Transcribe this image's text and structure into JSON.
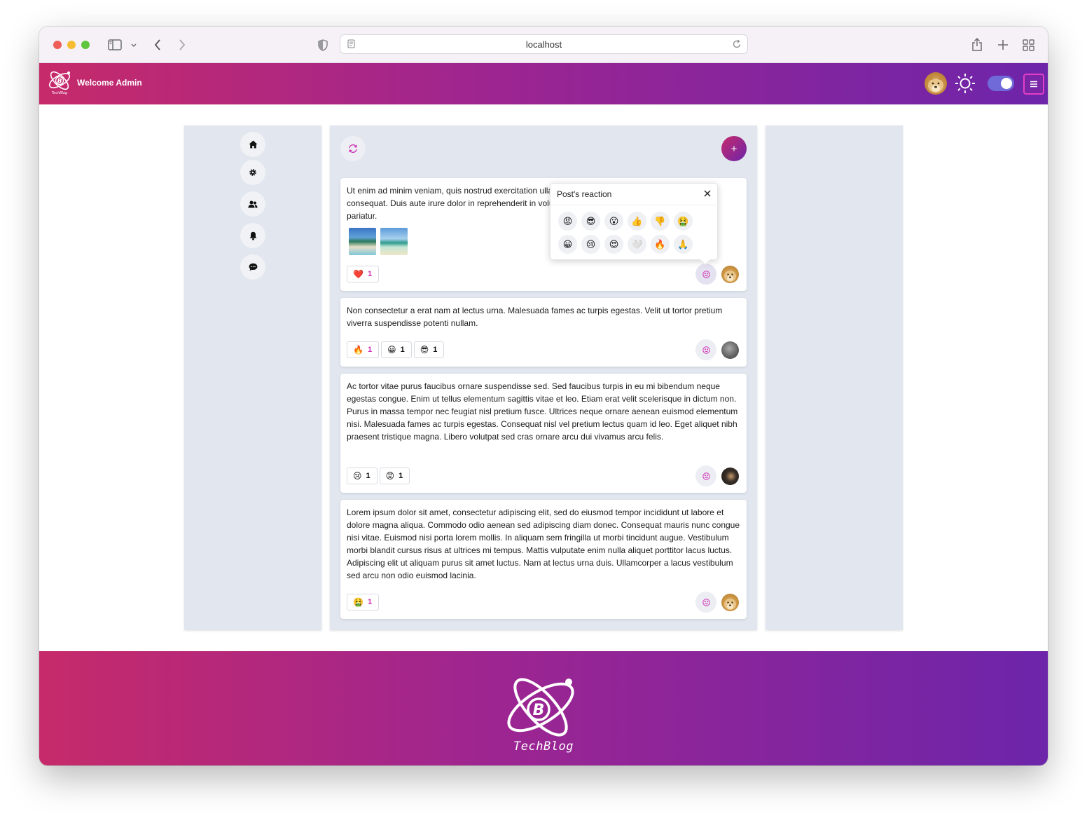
{
  "browser": {
    "url": "localhost"
  },
  "header": {
    "welcome": "Welcome Admin",
    "logo_text": "TechBlog",
    "accent_from": "#c62a6a",
    "accent_to": "#6d25aa",
    "theme_toggle_on": true
  },
  "sidebar": {
    "items": [
      {
        "name": "home",
        "icon": "home-icon"
      },
      {
        "name": "settings",
        "icon": "gear-icon"
      },
      {
        "name": "users",
        "icon": "users-icon"
      },
      {
        "name": "notifications",
        "icon": "bell-icon"
      },
      {
        "name": "messages",
        "icon": "chat-icon"
      }
    ]
  },
  "feed": {
    "add_label": "+",
    "posts": [
      {
        "text": "Ut enim ad minim veniam, quis nostrud exercitation ullamco laboris nisi ut aliquip ex ea commodo consequat. Duis aute irure dolor in reprehenderit in voluptate velit esse cillum dolore eu fugiat nulla pariatur.",
        "images": 2,
        "reactions": [
          {
            "emoji": "❤️",
            "count": "1",
            "highlight": true
          }
        ],
        "avatar": "doge"
      },
      {
        "text": "Non consectetur a erat nam at lectus urna. Malesuada fames ac turpis egestas. Velit ut tortor pretium viverra suspendisse potenti nullam.",
        "reactions": [
          {
            "emoji": "🔥",
            "count": "1",
            "highlight": true
          },
          {
            "emoji": "😀",
            "count": "1",
            "highlight": false
          },
          {
            "emoji": "😎",
            "count": "1",
            "highlight": false
          }
        ],
        "avatar": "gray"
      },
      {
        "text": "Ac tortor vitae purus faucibus ornare suspendisse sed. Sed faucibus turpis in eu mi bibendum neque egestas congue. Enim ut tellus elementum sagittis vitae et leo. Etiam erat velit scelerisque in dictum non. Purus in massa tempor nec feugiat nisl pretium fusce. Ultrices neque ornare aenean euismod elementum nisi. Malesuada fames ac turpis egestas. Consequat nisl vel pretium lectus quam id leo. Eget aliquet nibh praesent tristique magna. Libero volutpat sed cras ornare arcu dui vivamus arcu felis.",
        "reactions": [
          {
            "emoji": "😢",
            "count": "1",
            "highlight": false
          },
          {
            "emoji": "😡",
            "count": "1",
            "highlight": false
          }
        ],
        "avatar": "dark"
      },
      {
        "text": "Lorem ipsum dolor sit amet, consectetur adipiscing elit, sed do eiusmod tempor incididunt ut labore et dolore magna aliqua. Commodo odio aenean sed adipiscing diam donec. Consequat mauris nunc congue nisi vitae. Euismod nisi porta lorem mollis. In aliquam sem fringilla ut morbi tincidunt augue. Vestibulum morbi blandit cursus risus at ultrices mi tempus. Mattis vulputate enim nulla aliquet porttitor lacus luctus. Adipiscing elit ut aliquam purus sit amet luctus. Nam at lectus urna duis. Ullamcorper a lacus vestibulum sed arcu non odio euismod lacinia.",
        "reactions": [
          {
            "emoji": "🤮",
            "count": "1",
            "highlight": true
          }
        ],
        "avatar": "doge"
      }
    ]
  },
  "reaction_popover": {
    "title": "Post's reaction",
    "emojis": [
      "😡",
      "😎",
      "😮",
      "👍",
      "👎",
      "🤮",
      "😀",
      "😢",
      "😍",
      "🤍",
      "🔥",
      "🙏"
    ]
  },
  "footer": {
    "brand": "TechBlog"
  }
}
